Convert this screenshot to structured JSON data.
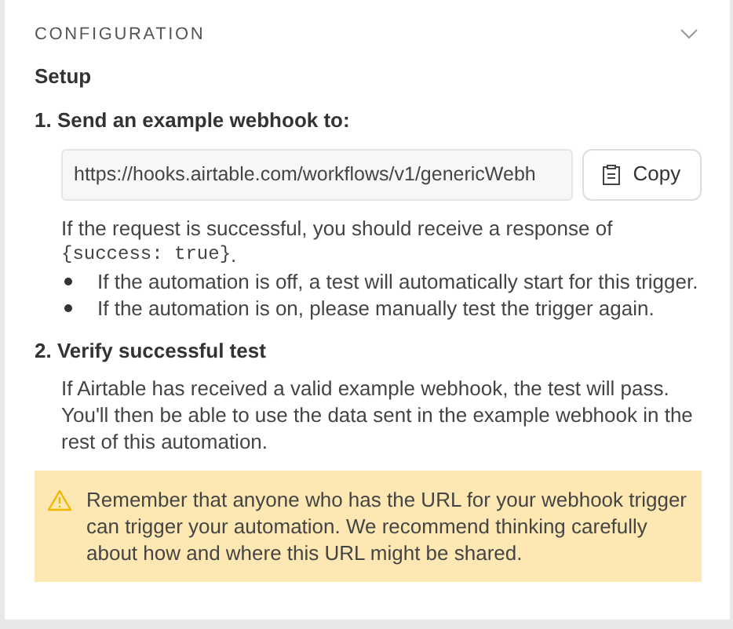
{
  "section": {
    "title": "CONFIGURATION",
    "expanded": true
  },
  "subtitle": "Setup",
  "step1": {
    "title": "1. Send an example webhook to:",
    "url": "https://hooks.airtable.com/workflows/v1/genericWebh",
    "copy_button": "Copy",
    "response_text": "If the request is successful, you should receive a response of",
    "response_code": "{success: true}",
    "response_end": ".",
    "bullets": [
      "If the automation is off, a test will automatically start for this trigger.",
      "If the automation is on, please manually test the trigger again."
    ]
  },
  "step2": {
    "title": "2. Verify successful test",
    "text": "If Airtable has received a valid example webhook, the test will pass. You'll then be able to use the data sent in the example webhook in the rest of this automation."
  },
  "warning": "Remember that anyone who has the URL for your webhook trigger can trigger your automation. We recommend thinking carefully about how and where this URL might be shared."
}
